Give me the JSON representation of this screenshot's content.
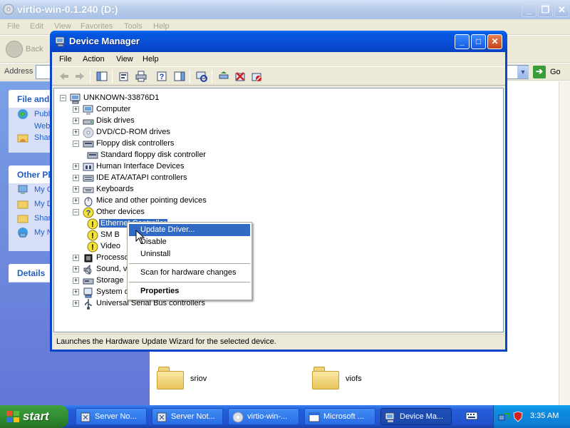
{
  "explorer": {
    "title": "virtio-win-0.1.240 (D:)",
    "menu": [
      "File",
      "Edit",
      "View",
      "Favorites",
      "Tools",
      "Help"
    ],
    "back_label": "Back",
    "address_label": "Address",
    "go_label": "Go",
    "taskpane": {
      "file_folder_head": "File and",
      "file_items": [
        "Publi",
        "Web",
        "Shar"
      ],
      "other_places_head": "Other Pl",
      "other_items": [
        "My C",
        "My D",
        "Shar",
        "My N"
      ],
      "details_head": "Details"
    },
    "folders": [
      "sriov",
      "viofs"
    ]
  },
  "device_manager": {
    "title": "Device Manager",
    "menu": [
      "File",
      "Action",
      "View",
      "Help"
    ],
    "tree": {
      "root": "UNKNOWN-33876D1",
      "items": [
        {
          "label": "Computer",
          "expander": "+",
          "icon": "computer-icon"
        },
        {
          "label": "Disk drives",
          "expander": "+",
          "icon": "disk-drive-icon"
        },
        {
          "label": "DVD/CD-ROM drives",
          "expander": "+",
          "icon": "cdrom-icon"
        },
        {
          "label": "Floppy disk controllers",
          "expander": "−",
          "icon": "floppy-controller-icon"
        },
        {
          "label": "Standard floppy disk controller",
          "expander": "",
          "icon": "floppy-controller-icon"
        },
        {
          "label": "Human Interface Devices",
          "expander": "+",
          "icon": "hid-icon"
        },
        {
          "label": "IDE ATA/ATAPI controllers",
          "expander": "+",
          "icon": "ide-controller-icon"
        },
        {
          "label": "Keyboards",
          "expander": "+",
          "icon": "keyboard-icon"
        },
        {
          "label": "Mice and other pointing devices",
          "expander": "+",
          "icon": "mouse-icon"
        },
        {
          "label": "Other devices",
          "expander": "−",
          "icon": "unknown-device-icon"
        },
        {
          "label": "Ethernet Controller",
          "expander": "",
          "icon": "warning-device-icon"
        },
        {
          "label": "SM B",
          "expander": "",
          "icon": "warning-device-icon"
        },
        {
          "label": "Video",
          "expander": "",
          "icon": "warning-device-icon"
        },
        {
          "label": "Processo",
          "expander": "+",
          "icon": "processor-icon"
        },
        {
          "label": "Sound, v",
          "expander": "+",
          "icon": "sound-icon"
        },
        {
          "label": "Storage",
          "expander": "+",
          "icon": "storage-icon"
        },
        {
          "label": "System d",
          "expander": "+",
          "icon": "system-device-icon"
        },
        {
          "label": "Universal Serial Bus controllers",
          "expander": "+",
          "icon": "usb-icon"
        }
      ]
    },
    "status": "Launches the Hardware Update Wizard for the selected device."
  },
  "context_menu": {
    "items": [
      "Update Driver...",
      "Disable",
      "Uninstall",
      "Scan for hardware changes",
      "Properties"
    ]
  },
  "taskbar": {
    "start_label": "start",
    "tasks": [
      {
        "label": "Server No...",
        "icon": "server-manager-icon"
      },
      {
        "label": "Server Not...",
        "icon": "server-manager-icon"
      },
      {
        "label": "virtio-win-...",
        "icon": "cdrom-icon"
      },
      {
        "label": "Microsoft ...",
        "icon": "window-icon"
      },
      {
        "label": "Device Ma...",
        "icon": "device-manager-icon",
        "active": true
      }
    ],
    "clock": "3:35 AM"
  },
  "colors": {
    "titlebar_blue": "#0a4ed6",
    "selection": "#316ac5",
    "taskbar": "#245edb",
    "start_green": "#2f8a2f"
  }
}
